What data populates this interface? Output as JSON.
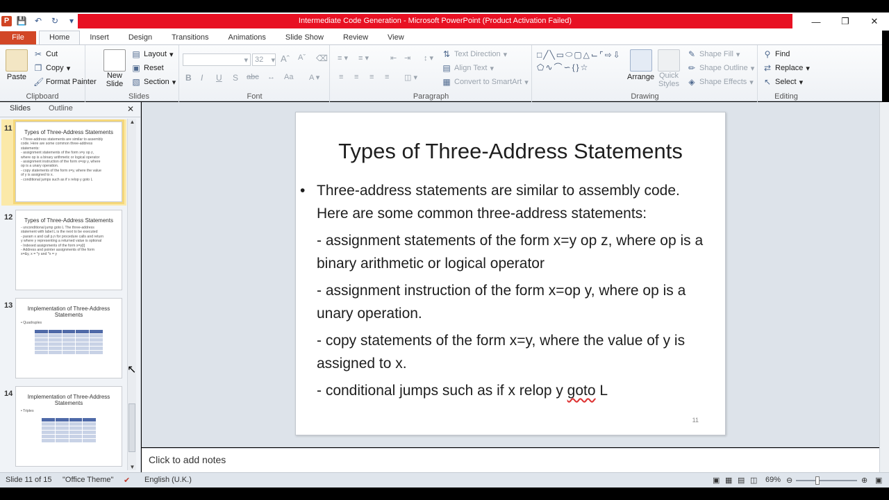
{
  "window": {
    "title": "Intermediate Code Generation  -  Microsoft PowerPoint (Product Activation Failed)",
    "app_icon": "P",
    "title_bar_color": "#e81123"
  },
  "ribbon_tabs": [
    "File",
    "Home",
    "Insert",
    "Design",
    "Transitions",
    "Animations",
    "Slide Show",
    "Review",
    "View"
  ],
  "ribbon": {
    "clipboard": {
      "paste": "Paste",
      "cut": "Cut",
      "copy": "Copy",
      "format_painter": "Format Painter",
      "label": "Clipboard"
    },
    "slides": {
      "new_slide_1": "New",
      "new_slide_2": "Slide",
      "layout": "Layout",
      "reset": "Reset",
      "section": "Section",
      "label": "Slides"
    },
    "font": {
      "size": "32",
      "bold": "B",
      "italic": "I",
      "underline": "U",
      "strikethrough": "S",
      "spacing": "abc",
      "case": "Aa",
      "label": "Font"
    },
    "paragraph": {
      "text_direction": "Text Direction",
      "align_text": "Align Text",
      "convert_smartart": "Convert to SmartArt",
      "label": "Paragraph"
    },
    "drawing": {
      "arrange": "Arrange",
      "quick_styles_1": "Quick",
      "quick_styles_2": "Styles",
      "shape_fill": "Shape Fill",
      "shape_outline": "Shape Outline",
      "shape_effects": "Shape Effects",
      "label": "Drawing"
    },
    "editing": {
      "find": "Find",
      "replace": "Replace",
      "select": "Select",
      "label": "Editing"
    }
  },
  "panel": {
    "tab_slides": "Slides",
    "tab_outline": "Outline",
    "thumbnails": [
      {
        "num": "11",
        "title": "Types of Three-Address Statements",
        "lines": [
          "• Three-address statements are similar to assembly",
          "  code.  Here are some common three-address",
          "  statements:",
          "- assignment statements of the form x=y op z,",
          "  where op is a binary arithmetic or logical operator",
          "- assignment instruction of the form x=op y, where",
          "  op is a unary operation.",
          "- copy statements of the form x=y, where the value",
          "  of y is assigned to x.",
          "- conditional jumps such as if x relop y goto L"
        ]
      },
      {
        "num": "12",
        "title": "Types of Three-Address Statements",
        "lines": [
          "- unconditional jump goto L The three-address",
          "  statement with label L is the next to be executed",
          "- param x and call p,n for procedure calls and return",
          "  y where y representing a returned value is optional",
          "- Indexed assignments of the form x=y[i]",
          "- Address and pointer assignments of the form",
          "  x=&y, x = *y and *x = y"
        ]
      },
      {
        "num": "13",
        "title": "Implementation of Three-Address Statements",
        "lines": [
          "• Quadruples"
        ]
      },
      {
        "num": "14",
        "title": "Implementation of Three-Address Statements",
        "lines": [
          "• Triples"
        ]
      }
    ]
  },
  "slide": {
    "title": "Types of Three-Address Statements",
    "bullet": "Three-address  statements are similar to assembly code.  Here are some common three-address statements:",
    "items": [
      "- assignment statements of the form x=y op z, where op is a binary arithmetic or logical operator",
      "- assignment instruction of the form x=op y, where op is a unary operation.",
      "- copy statements of the form x=y, where the value of y is assigned to x."
    ],
    "last_item_prefix": "- conditional jumps such as if x relop y ",
    "last_item_squiggle": "goto",
    "last_item_suffix": " L",
    "number": "11"
  },
  "notes_placeholder": "Click to add notes",
  "status": {
    "slide_of": "Slide 11 of 15",
    "theme": "\"Office Theme\"",
    "language": "English (U.K.)",
    "zoom": "69%"
  }
}
